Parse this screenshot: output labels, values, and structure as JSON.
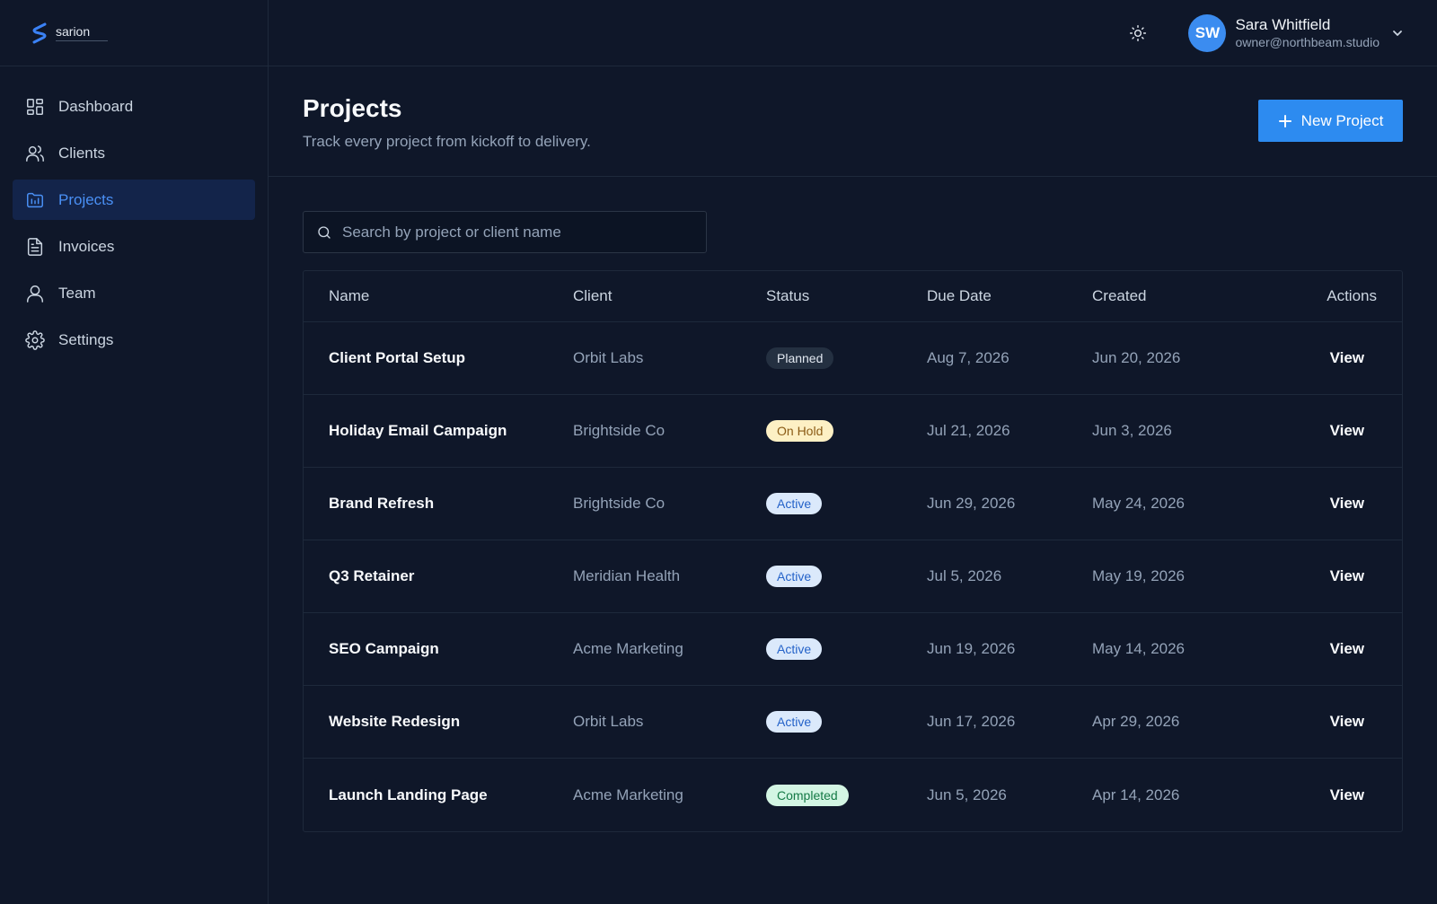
{
  "brand": {
    "name": "sarion"
  },
  "sidebar": {
    "items": [
      {
        "label": "Dashboard",
        "icon": "dashboard-icon",
        "active": false
      },
      {
        "label": "Clients",
        "icon": "users-icon",
        "active": false
      },
      {
        "label": "Projects",
        "icon": "projects-icon",
        "active": true
      },
      {
        "label": "Invoices",
        "icon": "invoice-icon",
        "active": false
      },
      {
        "label": "Team",
        "icon": "user-icon",
        "active": false
      },
      {
        "label": "Settings",
        "icon": "gear-icon",
        "active": false
      }
    ]
  },
  "header": {
    "theme_icon": "sun-icon",
    "user": {
      "initials": "SW",
      "name": "Sara Whitfield",
      "email": "owner@northbeam.studio"
    }
  },
  "page": {
    "title": "Projects",
    "subtitle": "Track every project from kickoff to delivery.",
    "new_button_label": "New Project"
  },
  "search": {
    "placeholder": "Search by project or client name",
    "value": ""
  },
  "table": {
    "columns": [
      "Name",
      "Client",
      "Status",
      "Due Date",
      "Created",
      "Actions"
    ],
    "rows": [
      {
        "name": "Client Portal Setup",
        "client": "Orbit Labs",
        "status": "Planned",
        "due": "Aug 7, 2026",
        "created": "Jun 20, 2026",
        "action": "View"
      },
      {
        "name": "Holiday Email Campaign",
        "client": "Brightside Co",
        "status": "On Hold",
        "due": "Jul 21, 2026",
        "created": "Jun 3, 2026",
        "action": "View"
      },
      {
        "name": "Brand Refresh",
        "client": "Brightside Co",
        "status": "Active",
        "due": "Jun 29, 2026",
        "created": "May 24, 2026",
        "action": "View"
      },
      {
        "name": "Q3 Retainer",
        "client": "Meridian Health",
        "status": "Active",
        "due": "Jul 5, 2026",
        "created": "May 19, 2026",
        "action": "View"
      },
      {
        "name": "SEO Campaign",
        "client": "Acme Marketing",
        "status": "Active",
        "due": "Jun 19, 2026",
        "created": "May 14, 2026",
        "action": "View"
      },
      {
        "name": "Website Redesign",
        "client": "Orbit Labs",
        "status": "Active",
        "due": "Jun 17, 2026",
        "created": "Apr 29, 2026",
        "action": "View"
      },
      {
        "name": "Launch Landing Page",
        "client": "Acme Marketing",
        "status": "Completed",
        "due": "Jun 5, 2026",
        "created": "Apr 14, 2026",
        "action": "View"
      }
    ]
  },
  "colors": {
    "accent": "#2d8bf0",
    "background": "#0f1729",
    "border": "#1e293b"
  }
}
